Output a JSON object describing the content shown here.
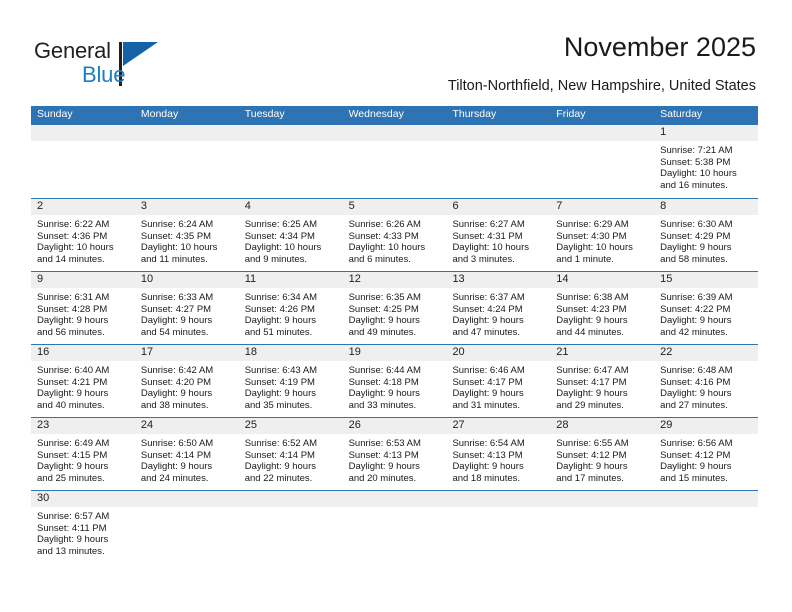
{
  "brand": {
    "name_top": "General",
    "name_bottom": "Blue",
    "flag_color": "#1463a8",
    "text_color": "#231f20",
    "blue_color": "#1b7fc4"
  },
  "header": {
    "title": "November 2025",
    "subtitle": "Tilton-Northfield, New Hampshire, United States",
    "accent_color": "#2e74b5",
    "band_color": "#efefef"
  },
  "weekdays": [
    "Sunday",
    "Monday",
    "Tuesday",
    "Wednesday",
    "Thursday",
    "Friday",
    "Saturday"
  ],
  "weeks": [
    [
      {
        "day": "",
        "sunrise": "",
        "sunset": "",
        "daylight1": "",
        "daylight2": ""
      },
      {
        "day": "",
        "sunrise": "",
        "sunset": "",
        "daylight1": "",
        "daylight2": ""
      },
      {
        "day": "",
        "sunrise": "",
        "sunset": "",
        "daylight1": "",
        "daylight2": ""
      },
      {
        "day": "",
        "sunrise": "",
        "sunset": "",
        "daylight1": "",
        "daylight2": ""
      },
      {
        "day": "",
        "sunrise": "",
        "sunset": "",
        "daylight1": "",
        "daylight2": ""
      },
      {
        "day": "",
        "sunrise": "",
        "sunset": "",
        "daylight1": "",
        "daylight2": ""
      },
      {
        "day": "1",
        "sunrise": "Sunrise: 7:21 AM",
        "sunset": "Sunset: 5:38 PM",
        "daylight1": "Daylight: 10 hours",
        "daylight2": "and 16 minutes."
      }
    ],
    [
      {
        "day": "2",
        "sunrise": "Sunrise: 6:22 AM",
        "sunset": "Sunset: 4:36 PM",
        "daylight1": "Daylight: 10 hours",
        "daylight2": "and 14 minutes."
      },
      {
        "day": "3",
        "sunrise": "Sunrise: 6:24 AM",
        "sunset": "Sunset: 4:35 PM",
        "daylight1": "Daylight: 10 hours",
        "daylight2": "and 11 minutes."
      },
      {
        "day": "4",
        "sunrise": "Sunrise: 6:25 AM",
        "sunset": "Sunset: 4:34 PM",
        "daylight1": "Daylight: 10 hours",
        "daylight2": "and 9 minutes."
      },
      {
        "day": "5",
        "sunrise": "Sunrise: 6:26 AM",
        "sunset": "Sunset: 4:33 PM",
        "daylight1": "Daylight: 10 hours",
        "daylight2": "and 6 minutes."
      },
      {
        "day": "6",
        "sunrise": "Sunrise: 6:27 AM",
        "sunset": "Sunset: 4:31 PM",
        "daylight1": "Daylight: 10 hours",
        "daylight2": "and 3 minutes."
      },
      {
        "day": "7",
        "sunrise": "Sunrise: 6:29 AM",
        "sunset": "Sunset: 4:30 PM",
        "daylight1": "Daylight: 10 hours",
        "daylight2": "and 1 minute."
      },
      {
        "day": "8",
        "sunrise": "Sunrise: 6:30 AM",
        "sunset": "Sunset: 4:29 PM",
        "daylight1": "Daylight: 9 hours",
        "daylight2": "and 58 minutes."
      }
    ],
    [
      {
        "day": "9",
        "sunrise": "Sunrise: 6:31 AM",
        "sunset": "Sunset: 4:28 PM",
        "daylight1": "Daylight: 9 hours",
        "daylight2": "and 56 minutes."
      },
      {
        "day": "10",
        "sunrise": "Sunrise: 6:33 AM",
        "sunset": "Sunset: 4:27 PM",
        "daylight1": "Daylight: 9 hours",
        "daylight2": "and 54 minutes."
      },
      {
        "day": "11",
        "sunrise": "Sunrise: 6:34 AM",
        "sunset": "Sunset: 4:26 PM",
        "daylight1": "Daylight: 9 hours",
        "daylight2": "and 51 minutes."
      },
      {
        "day": "12",
        "sunrise": "Sunrise: 6:35 AM",
        "sunset": "Sunset: 4:25 PM",
        "daylight1": "Daylight: 9 hours",
        "daylight2": "and 49 minutes."
      },
      {
        "day": "13",
        "sunrise": "Sunrise: 6:37 AM",
        "sunset": "Sunset: 4:24 PM",
        "daylight1": "Daylight: 9 hours",
        "daylight2": "and 47 minutes."
      },
      {
        "day": "14",
        "sunrise": "Sunrise: 6:38 AM",
        "sunset": "Sunset: 4:23 PM",
        "daylight1": "Daylight: 9 hours",
        "daylight2": "and 44 minutes."
      },
      {
        "day": "15",
        "sunrise": "Sunrise: 6:39 AM",
        "sunset": "Sunset: 4:22 PM",
        "daylight1": "Daylight: 9 hours",
        "daylight2": "and 42 minutes."
      }
    ],
    [
      {
        "day": "16",
        "sunrise": "Sunrise: 6:40 AM",
        "sunset": "Sunset: 4:21 PM",
        "daylight1": "Daylight: 9 hours",
        "daylight2": "and 40 minutes."
      },
      {
        "day": "17",
        "sunrise": "Sunrise: 6:42 AM",
        "sunset": "Sunset: 4:20 PM",
        "daylight1": "Daylight: 9 hours",
        "daylight2": "and 38 minutes."
      },
      {
        "day": "18",
        "sunrise": "Sunrise: 6:43 AM",
        "sunset": "Sunset: 4:19 PM",
        "daylight1": "Daylight: 9 hours",
        "daylight2": "and 35 minutes."
      },
      {
        "day": "19",
        "sunrise": "Sunrise: 6:44 AM",
        "sunset": "Sunset: 4:18 PM",
        "daylight1": "Daylight: 9 hours",
        "daylight2": "and 33 minutes."
      },
      {
        "day": "20",
        "sunrise": "Sunrise: 6:46 AM",
        "sunset": "Sunset: 4:17 PM",
        "daylight1": "Daylight: 9 hours",
        "daylight2": "and 31 minutes."
      },
      {
        "day": "21",
        "sunrise": "Sunrise: 6:47 AM",
        "sunset": "Sunset: 4:17 PM",
        "daylight1": "Daylight: 9 hours",
        "daylight2": "and 29 minutes."
      },
      {
        "day": "22",
        "sunrise": "Sunrise: 6:48 AM",
        "sunset": "Sunset: 4:16 PM",
        "daylight1": "Daylight: 9 hours",
        "daylight2": "and 27 minutes."
      }
    ],
    [
      {
        "day": "23",
        "sunrise": "Sunrise: 6:49 AM",
        "sunset": "Sunset: 4:15 PM",
        "daylight1": "Daylight: 9 hours",
        "daylight2": "and 25 minutes."
      },
      {
        "day": "24",
        "sunrise": "Sunrise: 6:50 AM",
        "sunset": "Sunset: 4:14 PM",
        "daylight1": "Daylight: 9 hours",
        "daylight2": "and 24 minutes."
      },
      {
        "day": "25",
        "sunrise": "Sunrise: 6:52 AM",
        "sunset": "Sunset: 4:14 PM",
        "daylight1": "Daylight: 9 hours",
        "daylight2": "and 22 minutes."
      },
      {
        "day": "26",
        "sunrise": "Sunrise: 6:53 AM",
        "sunset": "Sunset: 4:13 PM",
        "daylight1": "Daylight: 9 hours",
        "daylight2": "and 20 minutes."
      },
      {
        "day": "27",
        "sunrise": "Sunrise: 6:54 AM",
        "sunset": "Sunset: 4:13 PM",
        "daylight1": "Daylight: 9 hours",
        "daylight2": "and 18 minutes."
      },
      {
        "day": "28",
        "sunrise": "Sunrise: 6:55 AM",
        "sunset": "Sunset: 4:12 PM",
        "daylight1": "Daylight: 9 hours",
        "daylight2": "and 17 minutes."
      },
      {
        "day": "29",
        "sunrise": "Sunrise: 6:56 AM",
        "sunset": "Sunset: 4:12 PM",
        "daylight1": "Daylight: 9 hours",
        "daylight2": "and 15 minutes."
      }
    ],
    [
      {
        "day": "30",
        "sunrise": "Sunrise: 6:57 AM",
        "sunset": "Sunset: 4:11 PM",
        "daylight1": "Daylight: 9 hours",
        "daylight2": "and 13 minutes."
      },
      {
        "day": "",
        "sunrise": "",
        "sunset": "",
        "daylight1": "",
        "daylight2": ""
      },
      {
        "day": "",
        "sunrise": "",
        "sunset": "",
        "daylight1": "",
        "daylight2": ""
      },
      {
        "day": "",
        "sunrise": "",
        "sunset": "",
        "daylight1": "",
        "daylight2": ""
      },
      {
        "day": "",
        "sunrise": "",
        "sunset": "",
        "daylight1": "",
        "daylight2": ""
      },
      {
        "day": "",
        "sunrise": "",
        "sunset": "",
        "daylight1": "",
        "daylight2": ""
      },
      {
        "day": "",
        "sunrise": "",
        "sunset": "",
        "daylight1": "",
        "daylight2": ""
      }
    ]
  ]
}
